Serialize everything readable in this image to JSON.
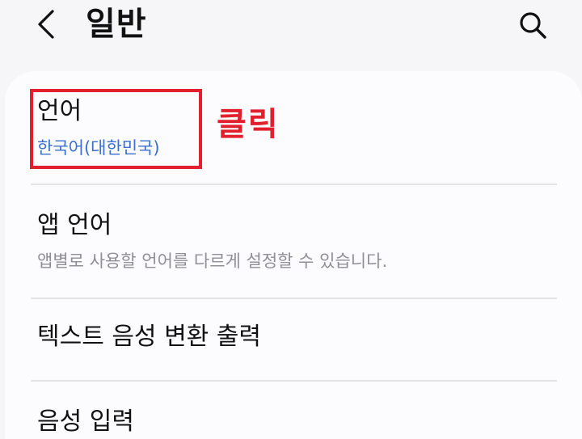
{
  "header": {
    "title": "일반",
    "back_icon": "chevron-left-icon",
    "search_icon": "search-icon"
  },
  "items": [
    {
      "title": "언어",
      "subtitle": "한국어(대한민국)"
    },
    {
      "title": "앱 언어",
      "subtitle": "앱별로 사용할 언어를 다르게 설정할 수 있습니다."
    },
    {
      "title": "텍스트 음성 변환 출력"
    },
    {
      "title": "음성 입력"
    }
  ],
  "annotation": {
    "label": "클릭",
    "color": "#e0202c"
  },
  "colors": {
    "accent_blue": "#3a6fd0",
    "highlight_red": "#e0202c",
    "secondary_gray": "#8f8f94"
  }
}
